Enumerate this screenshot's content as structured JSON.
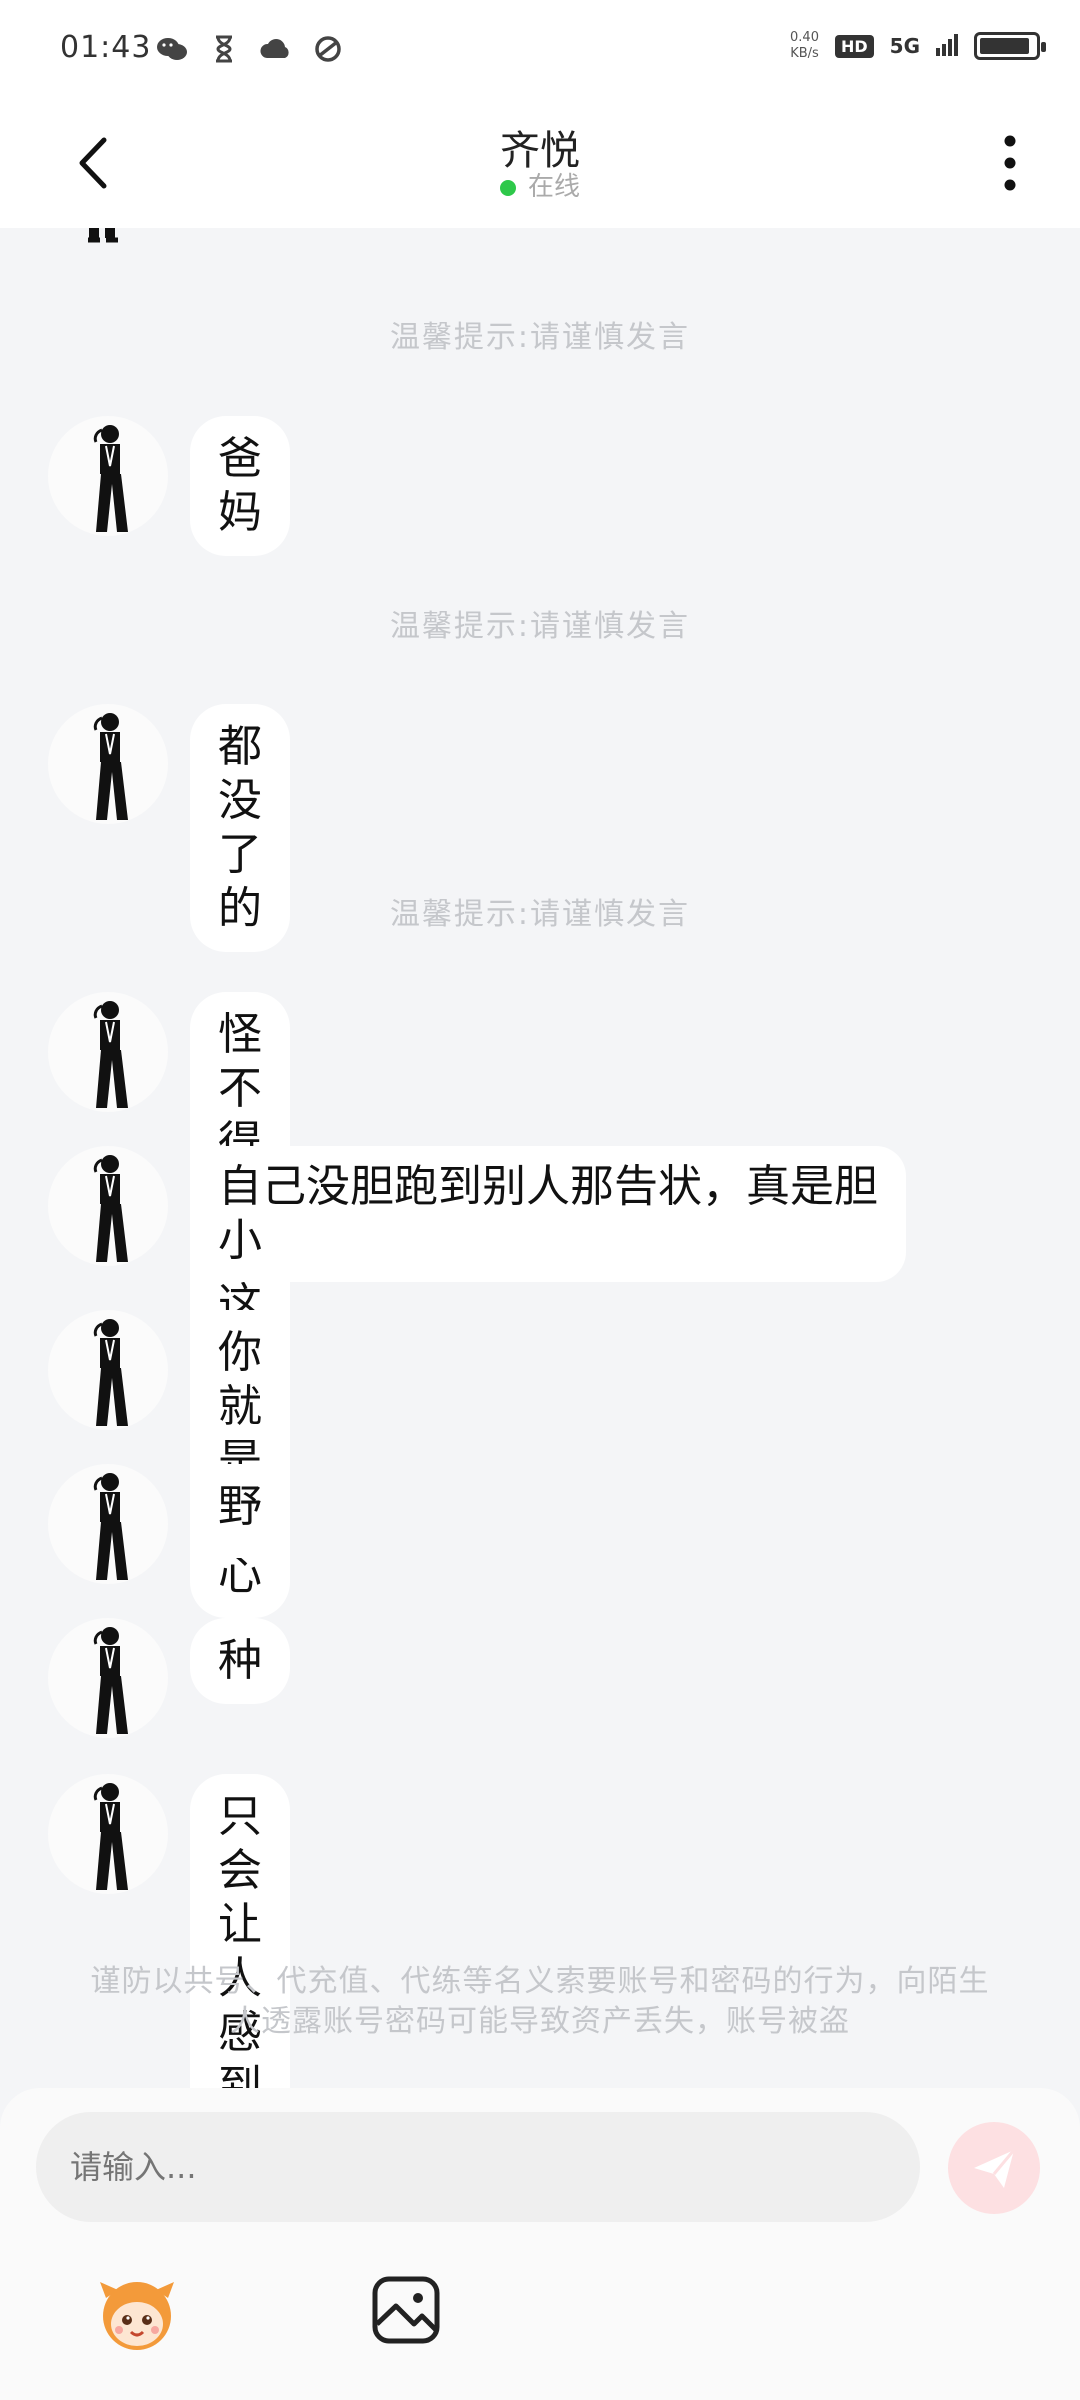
{
  "status_bar": {
    "time": "01:43",
    "net_speed_value": "0.40",
    "net_speed_unit": "KB/s",
    "hd_label": "HD",
    "network_label": "5G",
    "battery_level": 0.9
  },
  "header": {
    "title": "齐悦",
    "status": "在线"
  },
  "chat": {
    "tips": [
      "温馨提示:请谨慎发言",
      "温馨提示:请谨慎发言",
      "温馨提示:请谨慎发言"
    ],
    "messages": [
      {
        "text": "爸妈"
      },
      {
        "text": "都没了的"
      },
      {
        "text": "怪不得让人这么感到恶心"
      },
      {
        "text": "自己没胆跑到别人那告状，真是胆小"
      },
      {
        "text": "你就是个"
      },
      {
        "text": "野"
      },
      {
        "text": "种"
      },
      {
        "text": "只会让人感到恶心"
      }
    ],
    "warning": "谨防以共号、代充值、代练等名义索要账号和密码的行为，向陌生人透露账号密码可能导致资产丢失，账号被盗"
  },
  "composer": {
    "placeholder": "请输入..."
  },
  "icons": {
    "back": "back-arrow-icon",
    "more": "more-vertical-icon",
    "send": "send-icon",
    "emoji": "emoji-mascot-icon",
    "image": "image-icon"
  },
  "colors": {
    "online": "#2ec84a",
    "send_button": "#fde0e2",
    "background": "#f4f5f7"
  }
}
